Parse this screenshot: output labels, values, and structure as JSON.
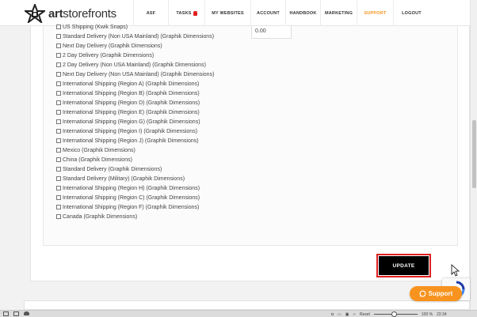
{
  "header": {
    "logo_bold": "art",
    "logo_light": "storefronts",
    "nav": [
      {
        "label": "ASF",
        "active": false
      },
      {
        "label": "TASKS",
        "active": false
      },
      {
        "label": "MY WEBSITES",
        "active": false
      },
      {
        "label": "ACCOUNT",
        "active": false
      },
      {
        "label": "HANDBOOK",
        "active": false
      },
      {
        "label": "MARKETING",
        "active": false
      },
      {
        "label": "SUPPORT",
        "active": true
      },
      {
        "label": "LOGOUT",
        "active": false
      }
    ]
  },
  "price_value": "0.00",
  "shipping_options": [
    "US Shipping (Kwik Snaps)",
    "Standard Delivery (Non USA Mainland) (Graphik Dimensions)",
    "Next Day Delivery (Graphik Dimensions)",
    "2 Day Delivery (Graphik Dimensions)",
    "2 Day Delivery (Non USA Mainland) (Graphik Dimensions)",
    "Next Day Delivery (Non USA Mainland) (Graphik Dimensions)",
    "International Shipping (Region A) (Graphik Dimensions)",
    "International Shipping (Region B) (Graphik Dimensions)",
    "International Shipping (Region D) (Graphik Dimensions)",
    "International Shipping (Region E) (Graphik Dimensions)",
    "International Shipping (Region G) (Graphik Dimensions)",
    "International Shipping (Region I) (Graphik Dimensions)",
    "International Shipping (Region J) (Graphik Dimensions)",
    "Mexico (Graphik Dimensions)",
    "China (Graphik Dimensions)",
    "Standard Delivery (Graphik Dimensions)",
    "Standard Delivery (Military) (Graphik Dimensions)",
    "International Shipping (Region H) (Graphik Dimensions)",
    "International Shipping (Region C) (Graphik Dimensions)",
    "International Shipping (Region F) (Graphik Dimensions)",
    "Canada (Graphik Dimensions)"
  ],
  "update_label": "UPDATE",
  "support_label": "Support",
  "statusbar": {
    "reset_label": "Reset",
    "zoom": "100 %",
    "time": "22:34"
  },
  "colors": {
    "accent": "#f7931e",
    "highlight": "#e02020"
  }
}
